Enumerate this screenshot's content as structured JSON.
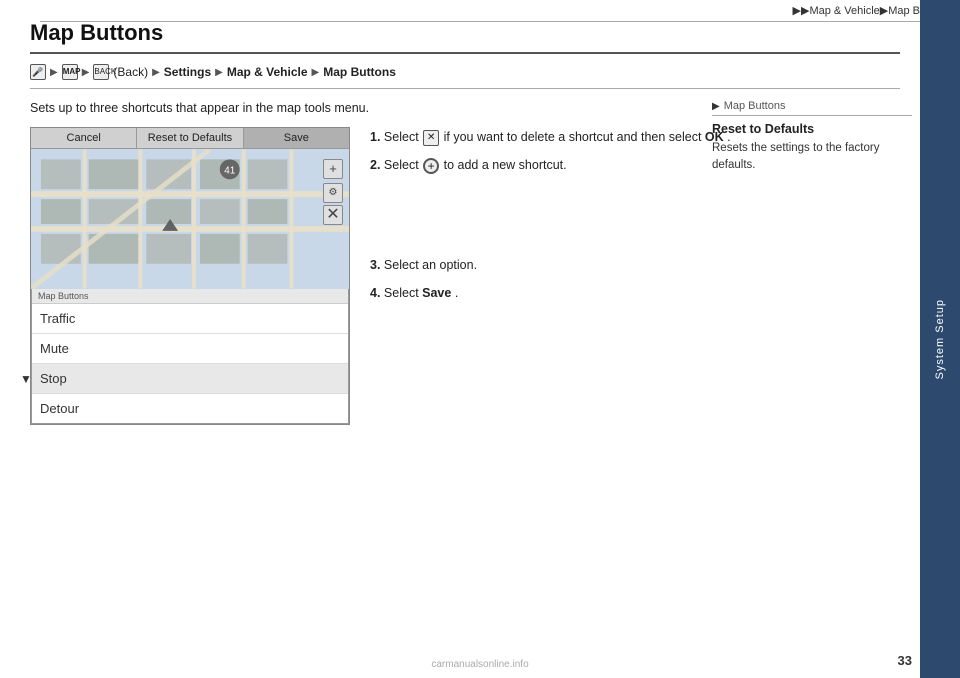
{
  "breadcrumb": {
    "text": "▶▶Map & Vehicle▶Map Buttons"
  },
  "page_title": "Map Buttons",
  "nav_path": {
    "mic_icon": "🎤",
    "map_label": "MAP",
    "back_label": "BACK",
    "steps": [
      "(Back)",
      "Settings",
      "Map & Vehicle",
      "Map Buttons"
    ]
  },
  "description": "Sets up to three shortcuts that appear in the map tools menu.",
  "map_toolbar": {
    "cancel": "Cancel",
    "reset": "Reset to Defaults",
    "save": "Save"
  },
  "menu": {
    "header": "Map Buttons",
    "items": [
      "Traffic",
      "Mute",
      "Stop",
      "Detour"
    ],
    "selected_index": 2
  },
  "instructions": [
    {
      "num": "1.",
      "parts": [
        {
          "type": "text",
          "value": "Select "
        },
        {
          "type": "icon-box",
          "value": "✕"
        },
        {
          "type": "text",
          "value": " if you want to delete a shortcut and then select "
        },
        {
          "type": "bold",
          "value": "OK"
        },
        {
          "type": "text",
          "value": "."
        }
      ]
    },
    {
      "num": "2.",
      "parts": [
        {
          "type": "text",
          "value": "Select "
        },
        {
          "type": "icon-circle",
          "value": "+"
        },
        {
          "type": "text",
          "value": " to add a new shortcut."
        }
      ]
    },
    {
      "num": "3.",
      "parts": [
        {
          "type": "text",
          "value": "Select an option."
        }
      ]
    },
    {
      "num": "4.",
      "parts": [
        {
          "type": "text",
          "value": "Select "
        },
        {
          "type": "bold",
          "value": "Save"
        },
        {
          "type": "text",
          "value": "."
        }
      ]
    }
  ],
  "info_panel": {
    "header": "Map Buttons",
    "play_icon": "▶",
    "title": "Reset to Defaults",
    "text": "Resets the settings to the factory defaults."
  },
  "sidebar": {
    "label": "System Setup"
  },
  "page_number": "33",
  "watermark": "carmanualsonline.info"
}
